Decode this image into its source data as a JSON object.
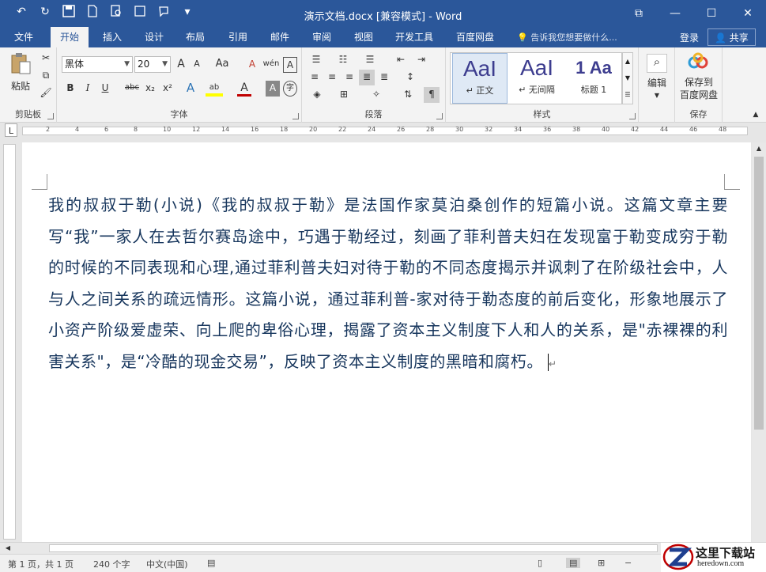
{
  "window": {
    "title": "演示文档.docx [兼容模式] - Word",
    "controls": [
      "⧉",
      "—",
      "☐",
      "✕"
    ]
  },
  "quick_access": {
    "undo": "↶",
    "redo": "↻",
    "save": "💾",
    "new": "▭",
    "preview": "🔍",
    "more": "▾"
  },
  "tabs": [
    "文件",
    "开始",
    "插入",
    "设计",
    "布局",
    "引用",
    "邮件",
    "审阅",
    "视图",
    "开发工具",
    "百度网盘"
  ],
  "active_tab": "开始",
  "tell_me": "告诉我您想要做什么...",
  "account": {
    "sign_in": "登录",
    "share": "共享"
  },
  "ribbon": {
    "clipboard": {
      "label": "剪贴板",
      "paste": "粘贴"
    },
    "font": {
      "label": "字体",
      "font_name": "黑体",
      "font_size": "20",
      "grow": "A",
      "shrink": "A",
      "case": "Aa",
      "clear": "A",
      "phonetic": "wén",
      "border": "A",
      "bold": "B",
      "italic": "I",
      "underline": "U",
      "strike": "abc",
      "subscript": "x₂",
      "superscript": "x²",
      "effects": "A",
      "highlight": "ab",
      "color": "A",
      "shade": "A",
      "circle": "字"
    },
    "paragraph": {
      "label": "段落"
    },
    "styles": {
      "label": "样式",
      "items": [
        {
          "sample": "AaI",
          "name": "↵ 正文"
        },
        {
          "sample": "AaI",
          "name": "↵ 无间隔"
        },
        {
          "sample": "1 Aa",
          "name": "标题 1"
        }
      ]
    },
    "editing": {
      "label": "编辑"
    },
    "save_group": {
      "label": "保存",
      "button_line1": "保存到",
      "button_line2": "百度网盘"
    }
  },
  "ruler": {
    "numbers": [
      "2",
      "4",
      "6",
      "8",
      "10",
      "12",
      "14",
      "16",
      "18",
      "20",
      "22",
      "24",
      "26",
      "28",
      "30",
      "32",
      "34",
      "36",
      "38",
      "40",
      "42",
      "44",
      "46",
      "48"
    ],
    "tab_stop": "L"
  },
  "document": {
    "text": "我的叔叔于勒(小说)《我的叔叔于勒》是法国作家莫泊桑创作的短篇小说。这篇文章主要写“我”一家人在去哲尔赛岛途中，巧遇于勒经过，刻画了菲利普夫妇在发现富于勒变成穷于勒的时候的不同表现和心理,通过菲利普夫妇对待于勒的不同态度揭示并讽刺了在阶级社会中，人与人之间关系的疏远情形。这篇小说，通过菲利普-家对待于勒态度的前后变化，形象地展示了小资产阶级爱虚荣、向上爬的卑俗心理，揭露了资本主义制度下人和人的关系，是\"赤裸裸的利害关系\"，是“冷酷的现金交易”，反映了资本主义制度的黑暗和腐朽。",
    "paragraph_mark": "↵"
  },
  "status": {
    "page": "第 1 页，共 1 页",
    "words": "240 个字",
    "language": "中文(中国)"
  },
  "watermark": {
    "text": "这里下载站",
    "url_text": "heredown.com"
  },
  "colors": {
    "title_bar": "#2b579a",
    "doc_text": "#17365d"
  }
}
